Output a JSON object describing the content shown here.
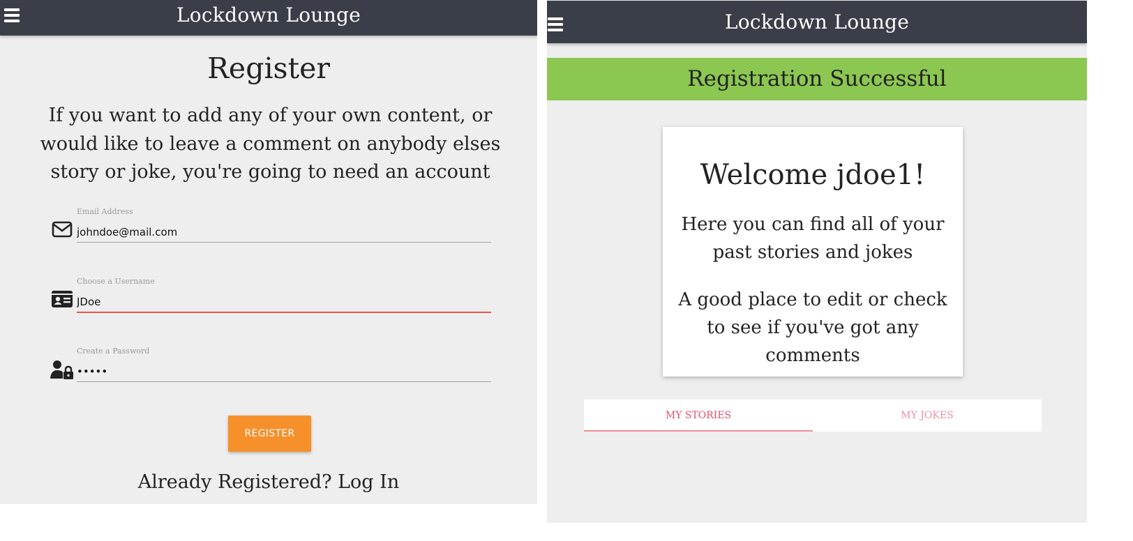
{
  "register_screen": {
    "navbar": {
      "title": "Lockdown Lounge",
      "menu_icon": "hamburger-menu-icon"
    },
    "heading": "Register",
    "intro": "If you want to add any of your own content, or would like to leave a comment on anybody elses story or joke, you're going to need an account",
    "fields": {
      "email": {
        "label": "Email Address",
        "value": "johndoe@mail.com",
        "icon": "envelope-icon"
      },
      "username": {
        "label": "Choose a Username",
        "value": "JDoe",
        "icon": "id-card-icon"
      },
      "password": {
        "label": "Create a Password",
        "value": "•••••",
        "icon": "user-lock-icon"
      }
    },
    "register_button": "REGISTER",
    "login_link": "Already Registered? Log In"
  },
  "profile_screen": {
    "navbar": {
      "title": "Lockdown Lounge",
      "menu_icon": "hamburger-menu-icon"
    },
    "banner": "Registration Successful",
    "card": {
      "title": "Welcome jdoe1!",
      "line1": "Here you can find all of your past stories and jokes",
      "line2": "A good place to edit or check to see if you've got any comments"
    },
    "tabs": [
      {
        "label": "MY STORIES",
        "active": true
      },
      {
        "label": "MY JOKES",
        "active": false
      }
    ]
  },
  "colors": {
    "navbar": "#3a3e48",
    "background": "#eeeeee",
    "register_button": "#f5902b",
    "success_banner": "#8bc751",
    "invalid_underline": "#e05a4a",
    "tab_accent": "#e2506a"
  }
}
